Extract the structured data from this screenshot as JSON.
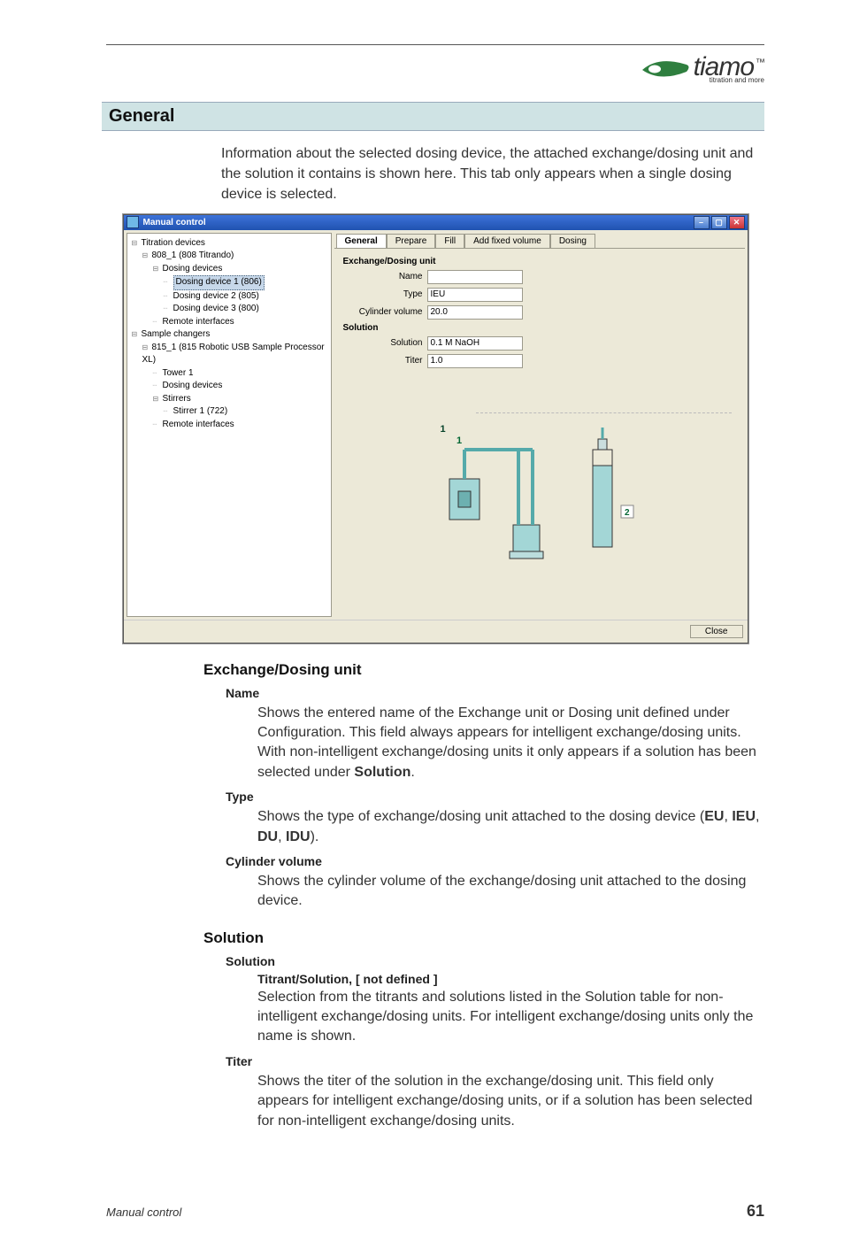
{
  "logo": {
    "main": "tiamo",
    "tm": "™",
    "sub": "titration and more"
  },
  "section_heading": "General",
  "intro": "Information about the selected dosing device, the attached exchange/dosing unit and the solution it contains is shown here. This tab only appears when a single dosing device is selected.",
  "window": {
    "title": "Manual control",
    "tree": {
      "n0": "Titration devices",
      "n1": "808_1 (808 Titrando)",
      "n2": "Dosing devices",
      "n3": "Dosing device 1 (806)",
      "n4": "Dosing device 2 (805)",
      "n5": "Dosing device 3 (800)",
      "n6": "Remote interfaces",
      "n7": "Sample changers",
      "n8": "815_1 (815 Robotic USB Sample Processor XL)",
      "n9": "Tower 1",
      "n10": "Dosing devices",
      "n11": "Stirrers",
      "n12": "Stirrer 1 (722)",
      "n13": "Remote interfaces"
    },
    "tabs": [
      "General",
      "Prepare",
      "Fill",
      "Add fixed volume",
      "Dosing"
    ],
    "group_exchange": "Exchange/Dosing unit",
    "group_solution": "Solution",
    "fields": {
      "name_label": "Name",
      "name_value": "",
      "type_label": "Type",
      "type_value": "IEU",
      "cyl_label": "Cylinder volume",
      "cyl_value": "20.0",
      "solution_label": "Solution",
      "solution_value": "0.1 M NaOH",
      "titer_label": "Titer",
      "titer_value": "1.0"
    },
    "diagram": {
      "label1": "1",
      "label2": "2"
    },
    "close_button": "Close"
  },
  "exchange_section": {
    "heading": "Exchange/Dosing unit",
    "name_label": "Name",
    "name_body_1": "Shows the entered name of the Exchange unit or Dosing unit defined under Configuration. This field always appears for intelligent exchange/dosing units. With non-intelligent exchange/dosing units it only appears if a solution has been selected under ",
    "name_body_bold": "Solution",
    "name_body_2": ".",
    "type_label": "Type",
    "type_body_1": "Shows the type of exchange/dosing unit attached to the dosing device (",
    "type_body_bold": "EU, IEU, DU, IDU",
    "type_body_2": ").",
    "cyl_label": "Cylinder volume",
    "cyl_body": "Shows the cylinder volume of the exchange/dosing unit attached to the dosing device."
  },
  "solution_section": {
    "heading": "Solution",
    "solution_label": "Solution",
    "solution_sub": "Titrant/Solution, [ not defined ]",
    "solution_body": "Selection from the titrants and solutions listed in the Solution table for non-intelligent exchange/dosing units. For intelligent exchange/dosing units only the name is shown.",
    "titer_label": "Titer",
    "titer_body": "Shows the titer of the solution in the exchange/dosing unit. This field only appears for intelligent exchange/dosing units, or if a solution has been selected for non-intelligent exchange/dosing units."
  },
  "footer": {
    "section": "Manual control",
    "page": "61"
  }
}
